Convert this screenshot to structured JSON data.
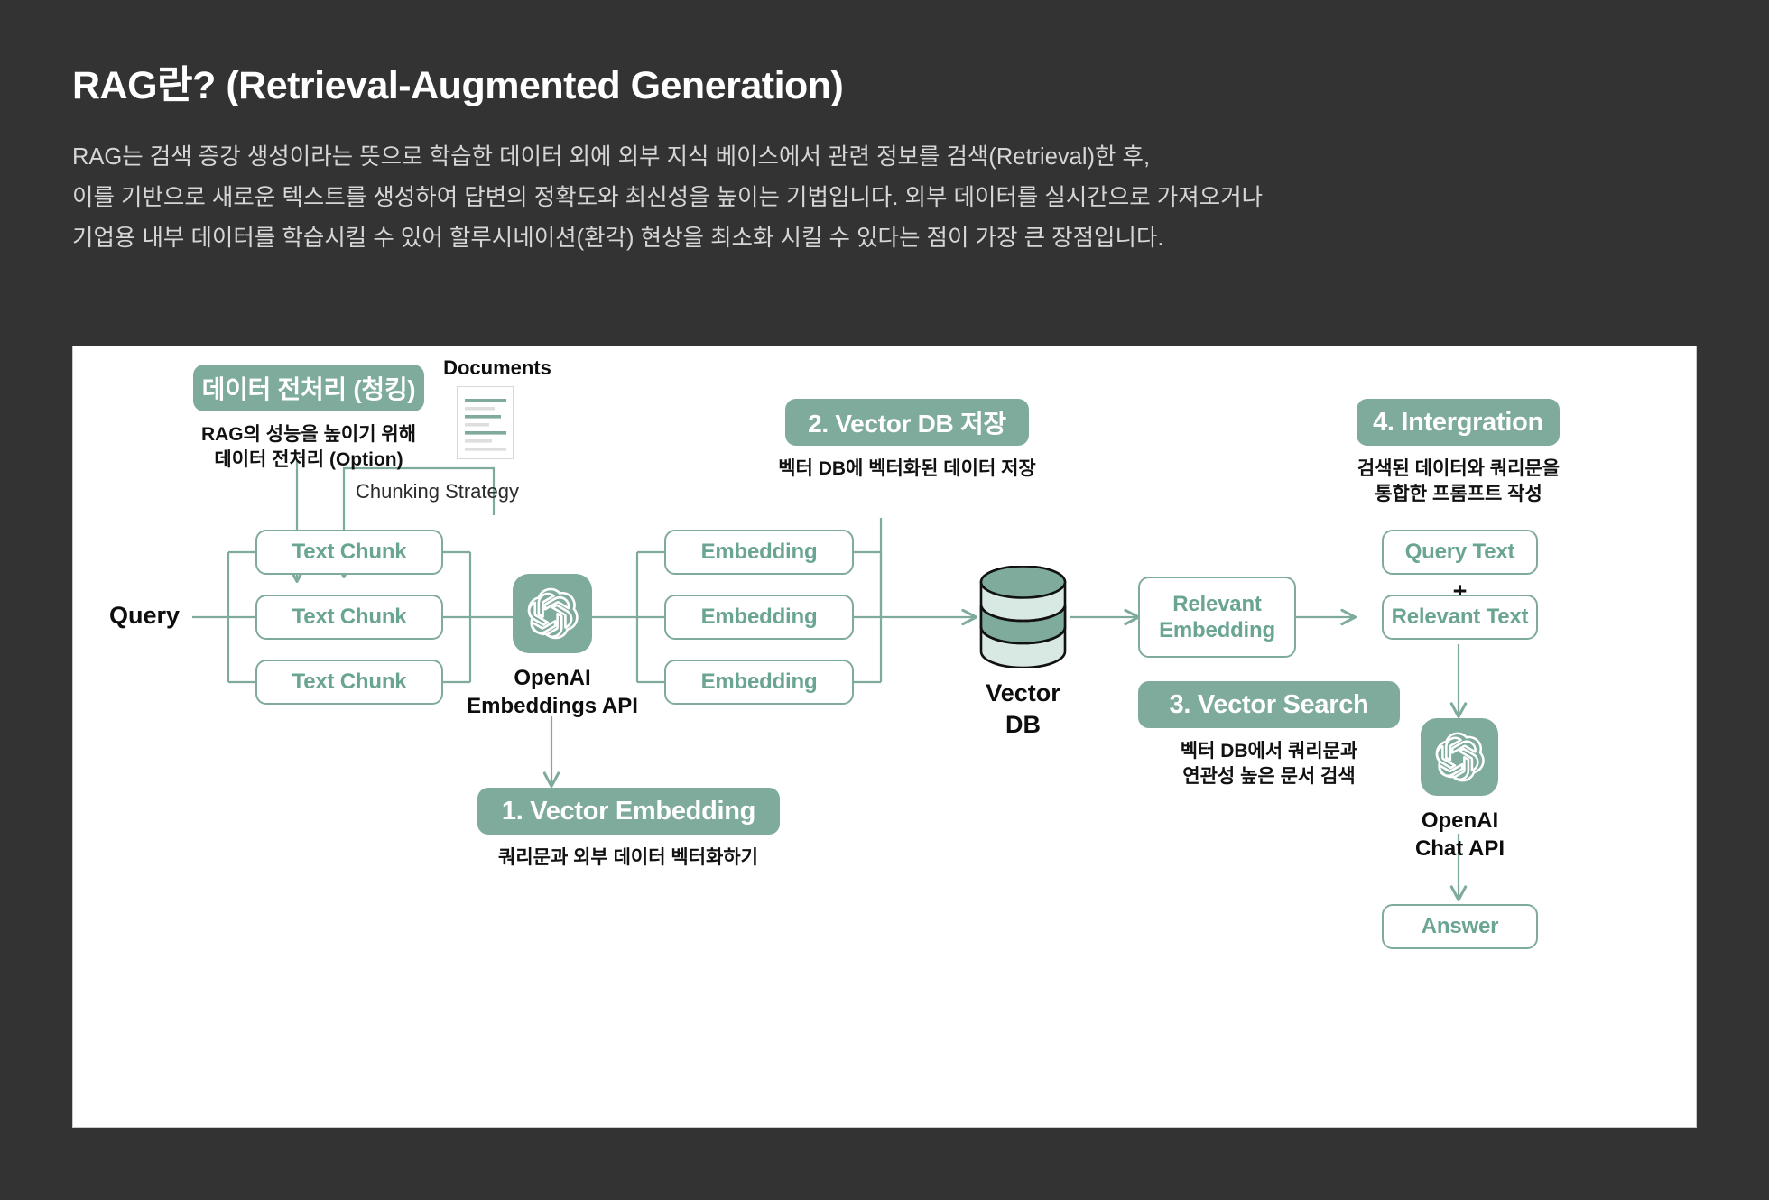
{
  "header": {
    "title": "RAG란? (Retrieval-Augmented Generation)",
    "description_lines": [
      "RAG는 검색 증강 생성이라는 뜻으로 학습한 데이터 외에 외부 지식 베이스에서 관련 정보를 검색(Retrieval)한 후,",
      "이를 기반으로 새로운 텍스트를 생성하여 답변의 정확도와 최신성을 높이는 기법입니다. 외부 데이터를 실시간으로 가져오거나",
      "기업용 내부 데이터를 학습시킬 수 있어 할루시네이션(환각) 현상을 최소화 시킬 수 있다는 점이 가장 큰 장점입니다."
    ]
  },
  "colors": {
    "page_background": "#333333",
    "canvas_background": "#ffffff",
    "accent_green": "#7fab9c",
    "accent_green_text": "#6aa492",
    "title_text": "#ffffff",
    "body_text": "#d6d6d6",
    "caption_text": "#111111"
  },
  "diagram": {
    "badges": {
      "chunking": "데이터 전처리 (청킹)",
      "step1": "1. Vector Embedding",
      "step2": "2. Vector DB 저장",
      "step3": "3. Vector Search",
      "step4": "4. Intergration"
    },
    "captions": {
      "chunking_l1": "RAG의 성능을 높이기 위해",
      "chunking_l2": "데이터 전처리 (Option)",
      "step1": "쿼리문과 외부 데이터 벡터화하기",
      "step2": "벡터 DB에 벡터화된 데이터 저장",
      "step3_l1": "벡터 DB에서 쿼리문과",
      "step3_l2": "연관성 높은 문서 검색",
      "step4_l1": "검색된 데이터와 쿼리문을",
      "step4_l2": "통합한 프롬프트 작성"
    },
    "labels": {
      "documents": "Documents",
      "chunking_strategy": "Chunking Strategy",
      "query": "Query",
      "openai_embeddings_l1": "OpenAI",
      "openai_embeddings_l2": "Embeddings API",
      "vector_db_l1": "Vector",
      "vector_db_l2": "DB",
      "openai_chat_l1": "OpenAI",
      "openai_chat_l2": "Chat API",
      "plus": "+"
    },
    "boxes": {
      "text_chunk_1": "Text Chunk",
      "text_chunk_2": "Text Chunk",
      "text_chunk_3": "Text Chunk",
      "embedding_1": "Embedding",
      "embedding_2": "Embedding",
      "embedding_3": "Embedding",
      "relevant_embedding_l1": "Relevant",
      "relevant_embedding_l2": "Embedding",
      "query_text": "Query Text",
      "relevant_text": "Relevant Text",
      "answer": "Answer"
    }
  }
}
